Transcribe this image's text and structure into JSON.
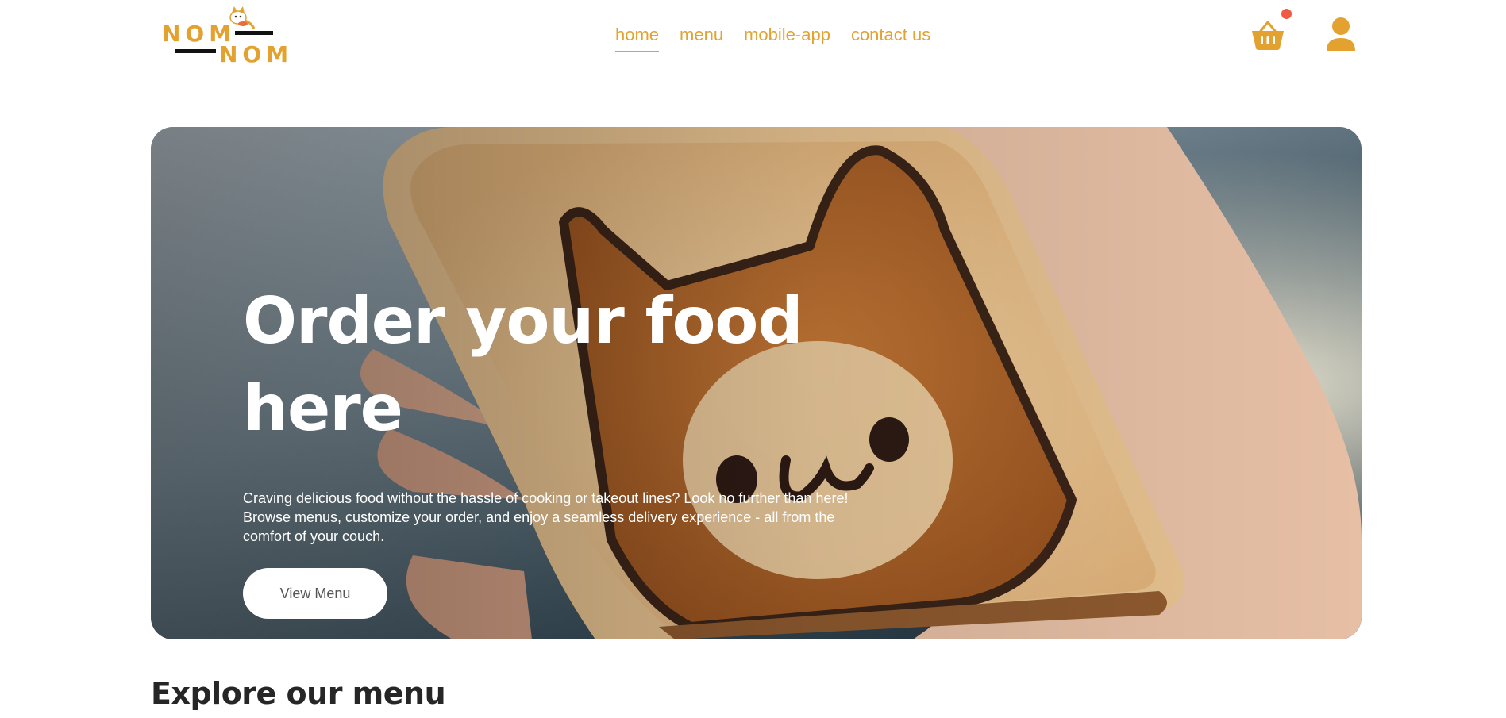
{
  "brand": {
    "logo_line1": "NOM",
    "logo_line2": "NOM",
    "accent_color": "#e3a230",
    "notification_color": "#f05a45"
  },
  "nav": {
    "items": [
      {
        "label": "home",
        "active": true
      },
      {
        "label": "menu",
        "active": false
      },
      {
        "label": "mobile-app",
        "active": false
      },
      {
        "label": "contact us",
        "active": false
      }
    ],
    "icons": [
      "basket-icon",
      "profile-icon"
    ]
  },
  "hero": {
    "title_line1": "Order your food",
    "title_line2": "here",
    "description": "Craving delicious food without the hassle of cooking or takeout lines? Look no further than here! Browse menus, customize your order, and enjoy a seamless delivery experience - all from the comfort of your couch.",
    "cta_label": "View Menu"
  },
  "explore": {
    "title": "Explore our menu"
  }
}
